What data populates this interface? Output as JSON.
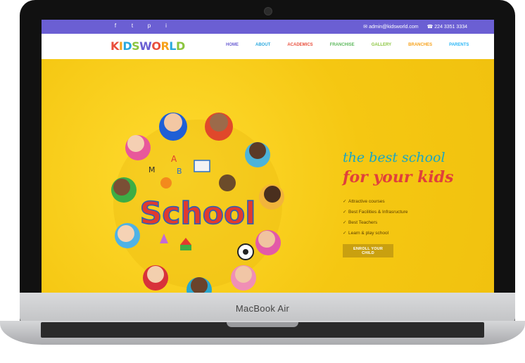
{
  "device": {
    "brand_label": "MacBook Air"
  },
  "topbar": {
    "social": [
      "f",
      "t",
      "p",
      "i"
    ],
    "email": "admin@kidsworld.com",
    "phone": "224 3351 3334"
  },
  "logo": {
    "letters": [
      "K",
      "I",
      "D",
      "S",
      "W",
      "O",
      "R",
      "L",
      "D"
    ],
    "colors": [
      "#e94e3c",
      "#f7a21b",
      "#29a8de",
      "#8bc53f",
      "#6b5fd3",
      "#e94e3c",
      "#f7a21b",
      "#29a8de",
      "#8bc53f"
    ]
  },
  "nav": {
    "items": [
      {
        "label": "HOME",
        "color": "#6b5fd3"
      },
      {
        "label": "ABOUT",
        "color": "#29a8de"
      },
      {
        "label": "ACADEMICS",
        "color": "#e94e3c"
      },
      {
        "label": "FRANCHISE",
        "color": "#5cb85c"
      },
      {
        "label": "GALLERY",
        "color": "#8bc53f"
      },
      {
        "label": "BRANCHES",
        "color": "#f7a21b"
      },
      {
        "label": "PARENTS",
        "color": "#29b6f6"
      }
    ]
  },
  "hero": {
    "illustration_word": "School",
    "tagline_top": "the best school",
    "tagline_bottom": "for your kids",
    "features": [
      "Attractive courses",
      "Best Facilities & Infrasructure",
      "Best Teachers",
      "Learn & play school"
    ],
    "cta_label": "ENROLL YOUR CHILD"
  },
  "colors": {
    "topbar": "#6b5fd3",
    "hero_bg": "#f5c712",
    "cta_bg": "#c9a010"
  }
}
